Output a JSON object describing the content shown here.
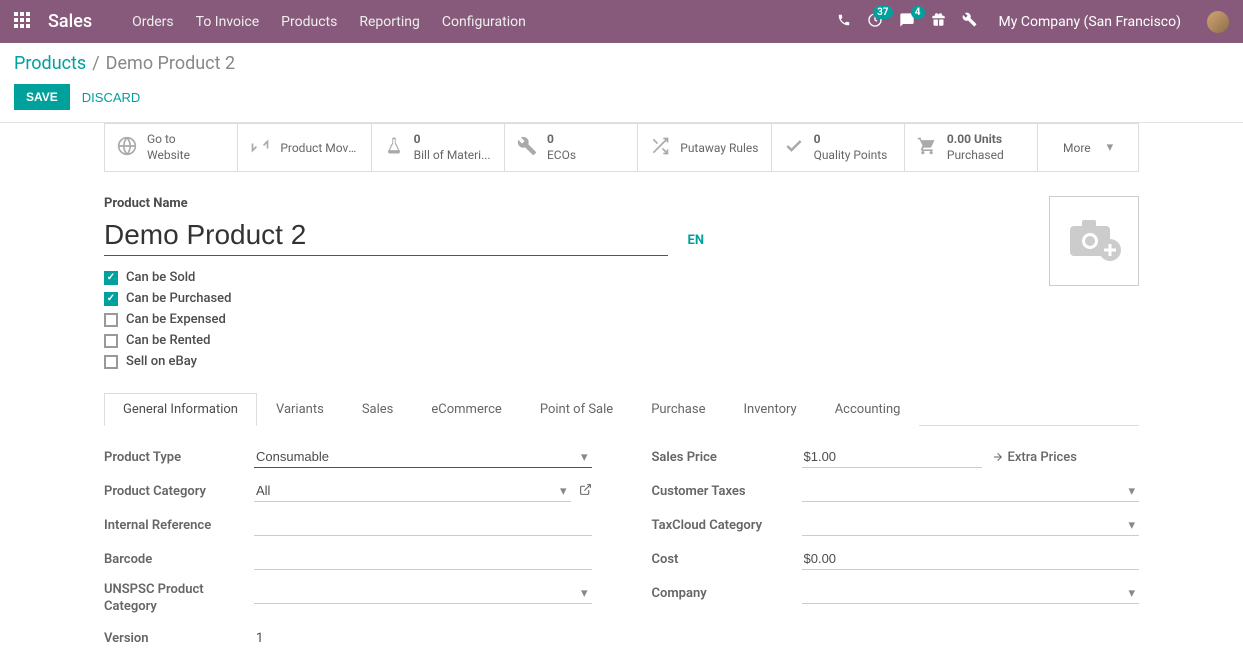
{
  "navbar": {
    "brand": "Sales",
    "menu": [
      "Orders",
      "To Invoice",
      "Products",
      "Reporting",
      "Configuration"
    ],
    "activity_count": "37",
    "message_count": "4",
    "company": "My Company (San Francisco)"
  },
  "breadcrumb": {
    "root": "Products",
    "current": "Demo Product 2"
  },
  "actions": {
    "save": "SAVE",
    "discard": "DISCARD"
  },
  "stat_buttons": [
    {
      "icon": "globe",
      "top": "Go to",
      "bottom": "Website"
    },
    {
      "icon": "swap",
      "label": "Product Moves"
    },
    {
      "icon": "flask",
      "top": "0",
      "bottom": "Bill of Materi..."
    },
    {
      "icon": "wrench",
      "top": "0",
      "bottom": "ECOs"
    },
    {
      "icon": "shuffle",
      "label": "Putaway Rules"
    },
    {
      "icon": "check",
      "top": "0",
      "bottom": "Quality Points"
    },
    {
      "icon": "cart",
      "top": "0.00 Units",
      "bottom": "Purchased"
    },
    {
      "icon": "more",
      "label": "More"
    }
  ],
  "form": {
    "product_name_label": "Product Name",
    "product_name": "Demo Product 2",
    "lang": "EN",
    "checkboxes": [
      {
        "label": "Can be Sold",
        "checked": true
      },
      {
        "label": "Can be Purchased",
        "checked": true
      },
      {
        "label": "Can be Expensed",
        "checked": false
      },
      {
        "label": "Can be Rented",
        "checked": false
      },
      {
        "label": "Sell on eBay",
        "checked": false
      }
    ]
  },
  "tabs": [
    "General Information",
    "Variants",
    "Sales",
    "eCommerce",
    "Point of Sale",
    "Purchase",
    "Inventory",
    "Accounting"
  ],
  "active_tab": 0,
  "fields_left": [
    {
      "label": "Product Type",
      "value": "Consumable",
      "type": "select",
      "focus": true
    },
    {
      "label": "Product Category",
      "value": "All",
      "type": "select",
      "extlink": true
    },
    {
      "label": "Internal Reference",
      "value": "",
      "type": "input"
    },
    {
      "label": "Barcode",
      "value": "",
      "type": "input"
    },
    {
      "label": "UNSPSC Product Category",
      "value": "",
      "type": "select"
    },
    {
      "label": "Version",
      "value": "1",
      "type": "static"
    }
  ],
  "fields_right": [
    {
      "label": "Sales Price",
      "value": "$1.00",
      "type": "input",
      "extra_prices": true
    },
    {
      "label": "Customer Taxes",
      "value": "",
      "type": "select"
    },
    {
      "label": "TaxCloud Category",
      "value": "",
      "type": "select"
    },
    {
      "label": "Cost",
      "value": "$0.00",
      "type": "input"
    },
    {
      "label": "Company",
      "value": "",
      "type": "select"
    }
  ],
  "extra_prices_label": "Extra Prices"
}
